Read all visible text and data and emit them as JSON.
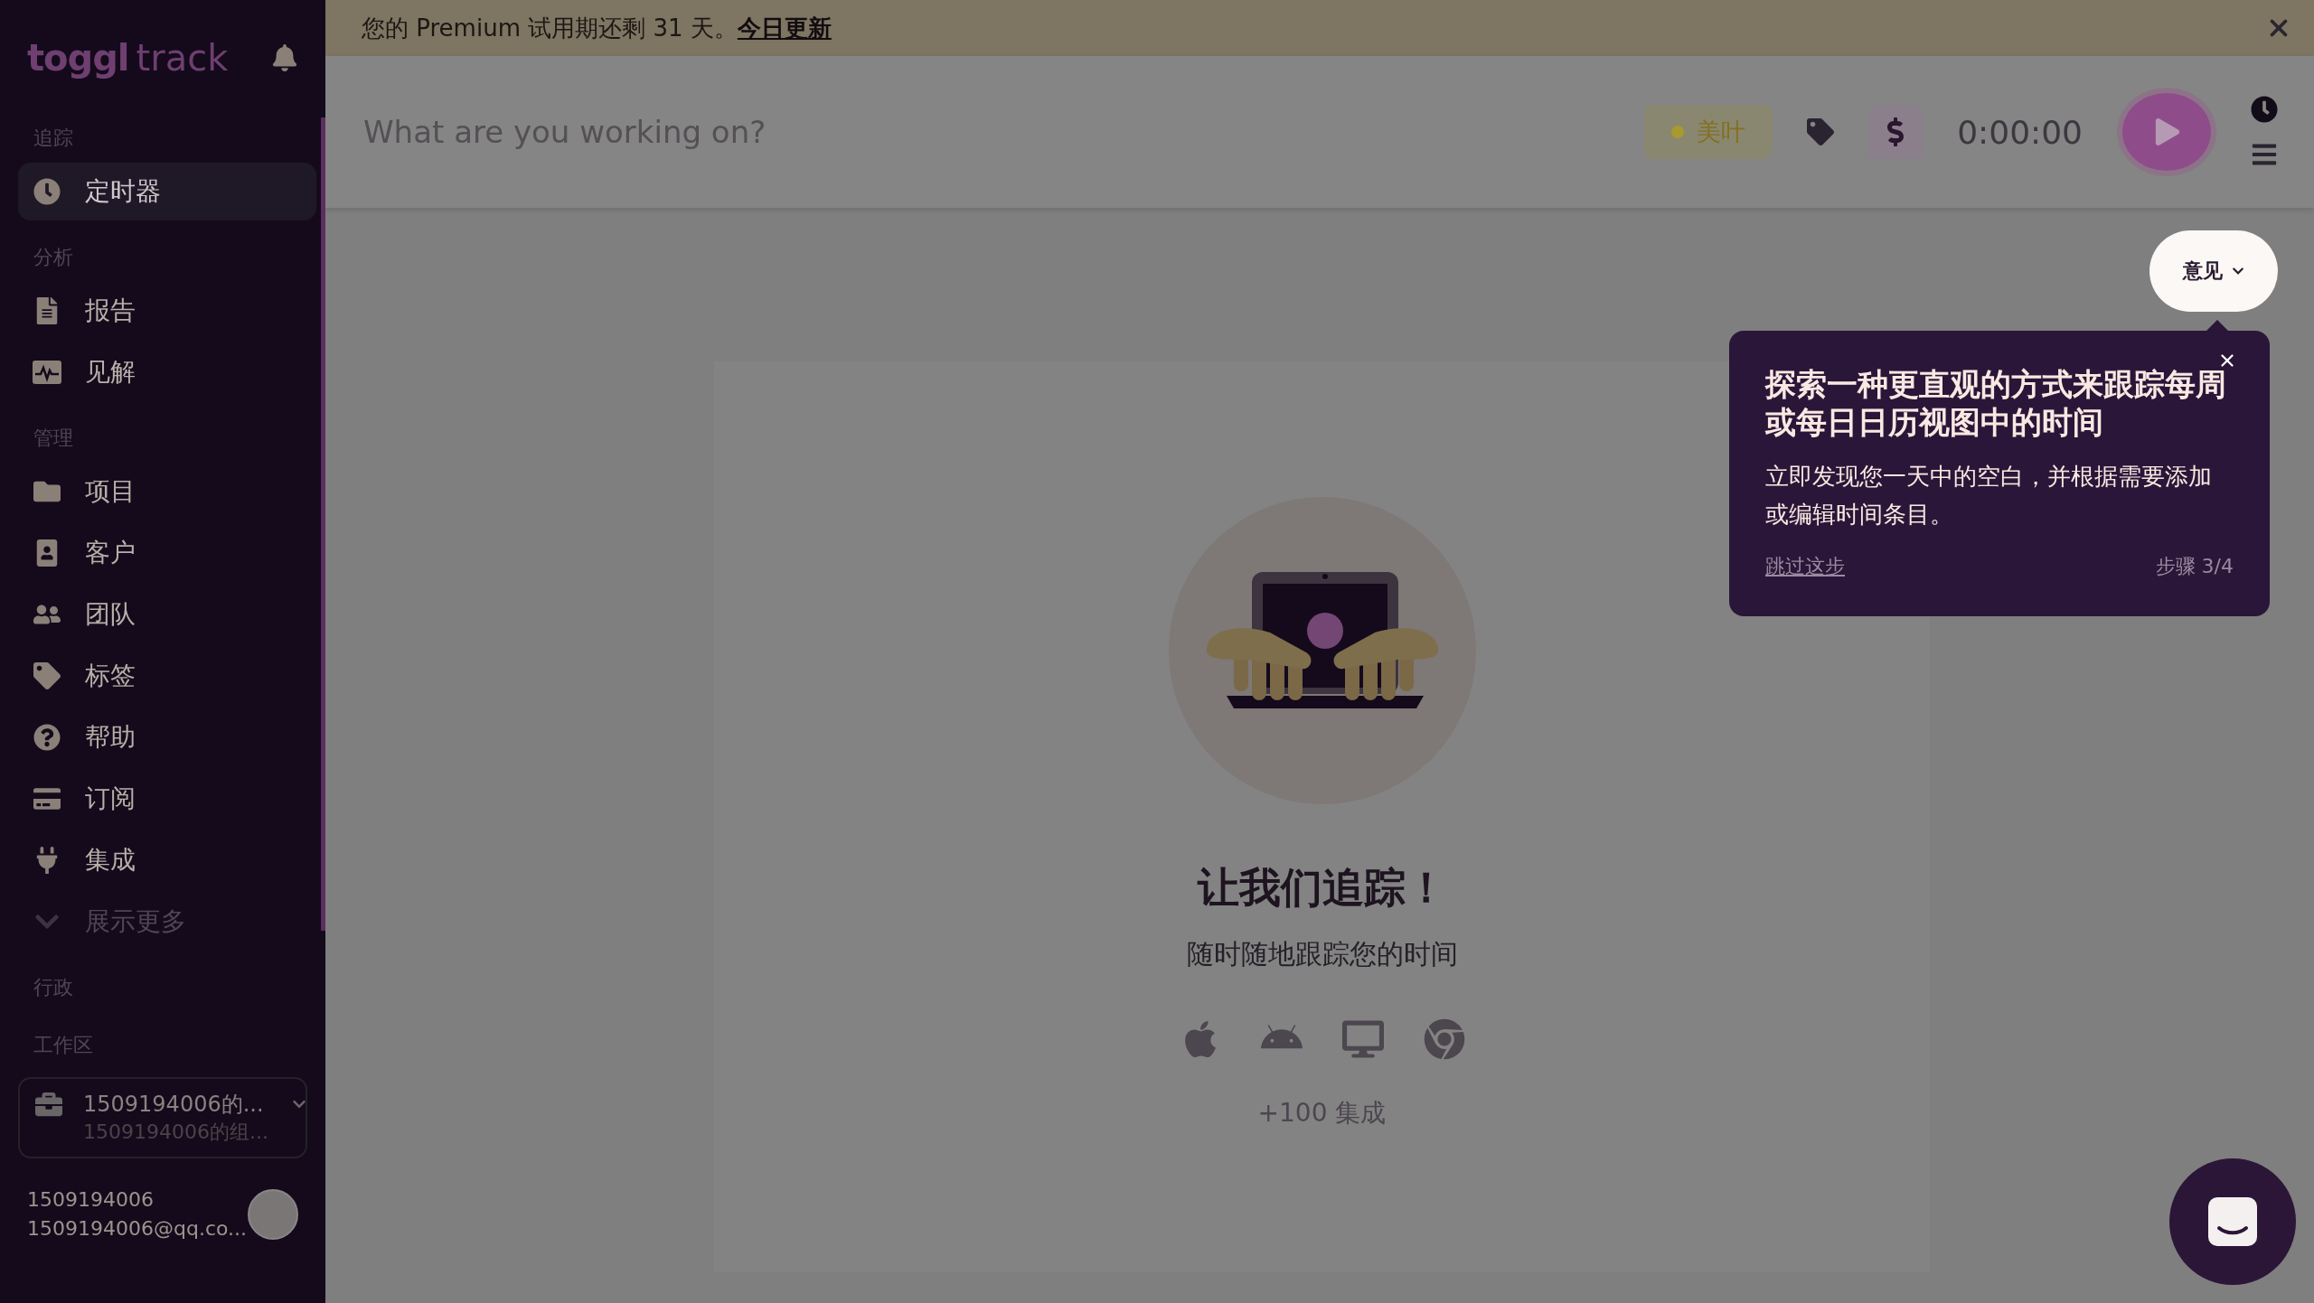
{
  "sidebar": {
    "logo": {
      "brand": "toggl",
      "product": "track"
    },
    "sections": [
      {
        "title": "追踪",
        "items": [
          {
            "label": "定时器",
            "selected": true
          }
        ]
      },
      {
        "title": "分析",
        "items": [
          {
            "label": "报告",
            "selected": false
          },
          {
            "label": "见解",
            "selected": false
          }
        ]
      },
      {
        "title": "管理",
        "items": [
          {
            "label": "项目",
            "selected": false
          },
          {
            "label": "客户",
            "selected": false
          },
          {
            "label": "团队",
            "selected": false
          },
          {
            "label": "标签",
            "selected": false
          },
          {
            "label": "帮助",
            "selected": false
          },
          {
            "label": "订阅",
            "selected": false
          },
          {
            "label": "集成",
            "selected": false
          }
        ],
        "show_more": {
          "label": "展示更多",
          "expanded": false
        }
      },
      {
        "title": "行政"
      }
    ],
    "workspace": {
      "title": "工作区",
      "name": "1509194006的...",
      "organization": "1509194006的组..."
    },
    "user": {
      "name": "1509194006",
      "email": "1509194006@qq.co..."
    }
  },
  "banner": {
    "text": "您的 Premium 试用期还剩 31 天。",
    "link": "今日更新"
  },
  "timer": {
    "placeholder": "What are you working on?",
    "project": {
      "name": "美叶",
      "color": "#a89a2c"
    },
    "billable": true,
    "duration": "0:00:00"
  },
  "feedback": {
    "label": "意见"
  },
  "empty_state": {
    "title": "让我们追踪！",
    "subtitle": "随时随地跟踪您的时间",
    "integrations": "+100 集成"
  },
  "tour": {
    "title": "探索一种更直观的方式来跟踪每周或每日日历视图中的时间",
    "body": "立即发现您一天中的空白，并根据需要添加或编辑时间条目。",
    "skip": "跳过这步",
    "step": "步骤 3/4"
  }
}
